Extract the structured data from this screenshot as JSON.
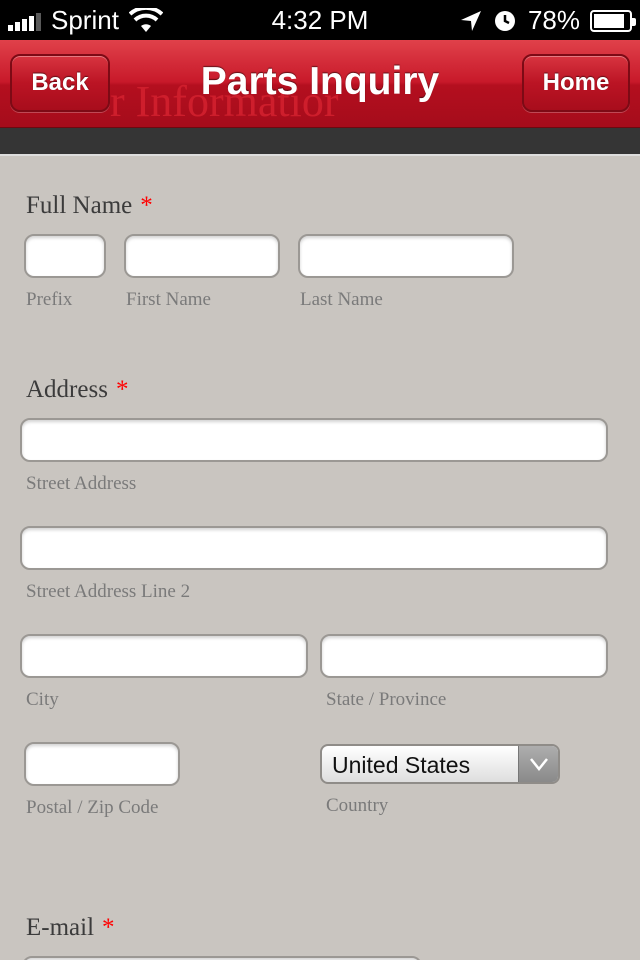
{
  "status_bar": {
    "carrier": "Sprint",
    "time": "4:32 PM",
    "battery_percent": "78%",
    "battery_level": 0.78,
    "icons": [
      "signal-icon",
      "wifi-icon",
      "location-icon",
      "clock-icon",
      "battery-icon"
    ]
  },
  "nav": {
    "title": "Parts Inquiry",
    "ghost_text": "r Informatior",
    "back_label": "Back",
    "home_label": "Home",
    "accent": "#c8192a"
  },
  "form": {
    "full_name": {
      "label": "Full Name",
      "required": "*",
      "prefix": "Prefix",
      "first": "First Name",
      "last": "Last Name"
    },
    "address": {
      "label": "Address",
      "required": "*",
      "street": "Street Address",
      "street2": "Street Address Line 2",
      "city": "City",
      "state": "State / Province",
      "postal": "Postal / Zip Code",
      "country_label": "Country",
      "country_value": "United States"
    },
    "email": {
      "label": "E-mail",
      "required": "*"
    }
  }
}
